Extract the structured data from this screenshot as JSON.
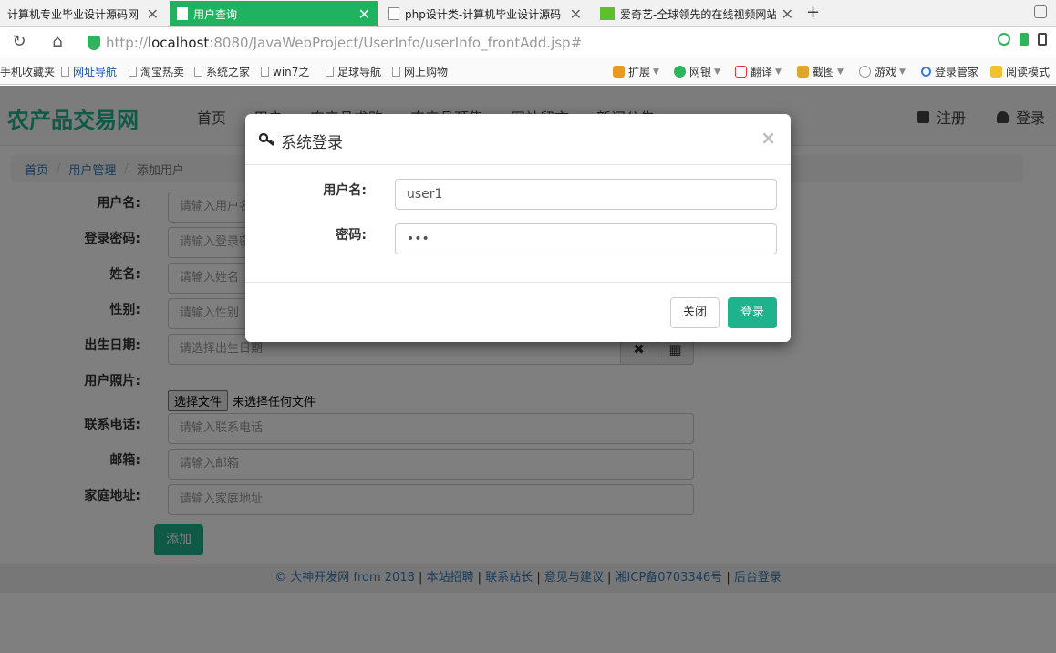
{
  "browser": {
    "tabs": [
      {
        "label": "计算机专业毕业设计源码网",
        "active": false
      },
      {
        "label": "用户查询",
        "active": true
      },
      {
        "label": "php设计类-计算机毕业设计源码",
        "active": false
      },
      {
        "label": "爱奇艺-全球领先的在线视频网站",
        "active": false
      }
    ],
    "url_prefix": "http://",
    "url_host": "localhost",
    "url_rest": ":8080/JavaWebProject/UserInfo/userInfo_frontAdd.jsp#",
    "bookmarks": [
      {
        "label": "手机收藏夹"
      },
      {
        "label": "网址导航"
      },
      {
        "label": "淘宝热卖"
      },
      {
        "label": "系统之家"
      },
      {
        "label": "win7之"
      },
      {
        "label": "足球导航"
      },
      {
        "label": "网上购物"
      }
    ],
    "tools": [
      {
        "label": "扩展"
      },
      {
        "label": "网银"
      },
      {
        "label": "翻译"
      },
      {
        "label": "截图"
      },
      {
        "label": "游戏"
      },
      {
        "label": "登录管家"
      },
      {
        "label": "阅读模式"
      }
    ]
  },
  "site": {
    "brand": "农产品交易网",
    "nav": [
      "首页",
      "用户",
      "农产品求购",
      "农产品预售",
      "网站留言",
      "新闻公告"
    ],
    "register": "注册",
    "login": "登录"
  },
  "breadcrumb": {
    "home": "首页",
    "section": "用户管理",
    "current": "添加用户"
  },
  "form": {
    "username": {
      "label": "用户名:",
      "placeholder": "请输入用户名"
    },
    "password": {
      "label": "登录密码:",
      "placeholder": "请输入登录密码"
    },
    "name": {
      "label": "姓名:",
      "placeholder": "请输入姓名"
    },
    "gender": {
      "label": "性别:",
      "placeholder": "请输入性别"
    },
    "birthday": {
      "label": "出生日期:",
      "placeholder": "请选择出生日期"
    },
    "photo": {
      "label": "用户照片:",
      "button": "选择文件",
      "status": "未选择任何文件"
    },
    "phone": {
      "label": "联系电话:",
      "placeholder": "请输入联系电话"
    },
    "email": {
      "label": "邮箱:",
      "placeholder": "请输入邮箱"
    },
    "address": {
      "label": "家庭地址:",
      "placeholder": "请输入家庭地址"
    },
    "submit": "添加"
  },
  "footer": {
    "items": [
      "© 大神开发网 from 2018",
      "本站招聘",
      "联系站长",
      "意见与建议",
      "湘ICP备0703346号",
      "后台登录"
    ]
  },
  "modal": {
    "title": "系统登录",
    "close_glyph": "×",
    "user_label": "用户名:",
    "user_value": "user1",
    "pwd_label": "密码:",
    "pwd_value": "•••",
    "close_btn": "关闭",
    "login_btn": "登录"
  },
  "colors": {
    "accent": "#1fb38d",
    "tab_active": "#1fb35f",
    "link": "#337ab7"
  }
}
